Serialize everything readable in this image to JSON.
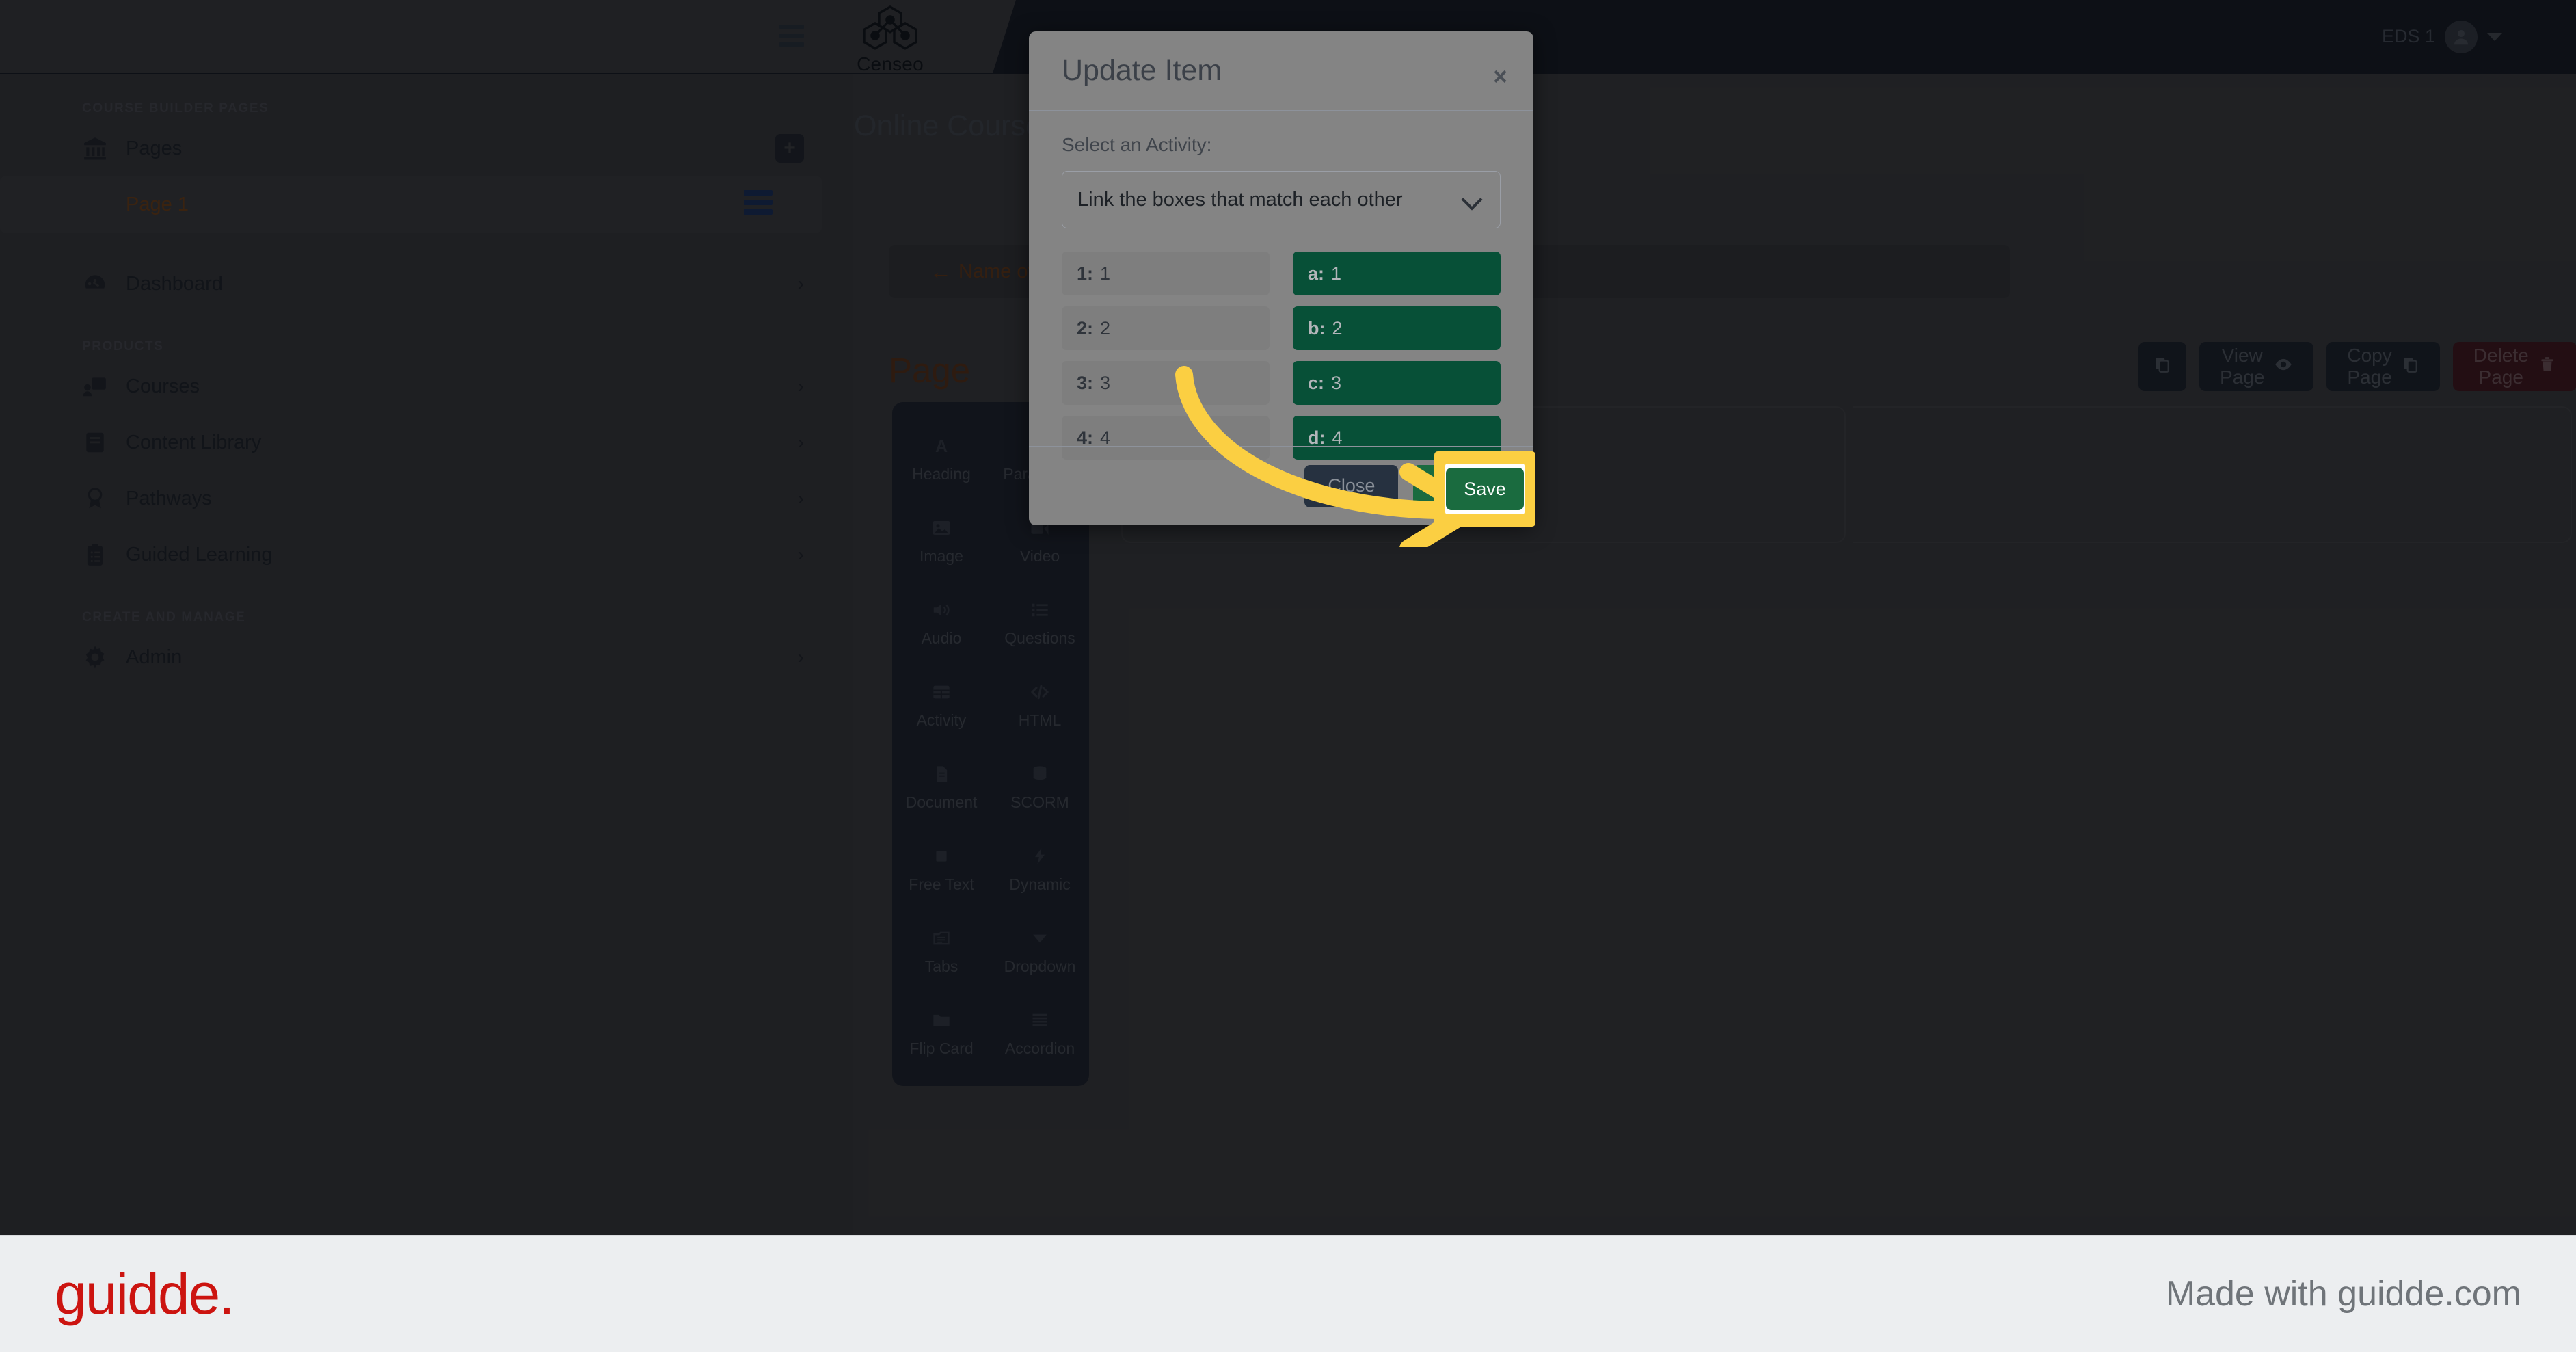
{
  "topbar": {
    "menu_icon": "hamburger-icon",
    "brand_name": "Censeo",
    "brand_mark_icon": "censeo-molecule-logo",
    "user_name": "EDS 1",
    "avatar_icon": "user-avatar-icon",
    "caret_icon": "chevron-down-icon"
  },
  "sidebar": {
    "groups": [
      {
        "label": "COURSE BUILDER PAGES",
        "items": [
          {
            "label": "Pages",
            "icon": "bank-icon",
            "trailing": "plus-icon",
            "active": false
          },
          {
            "label": "Page 1",
            "icon": "none",
            "trailing": "list-burger-icon",
            "active": true
          }
        ]
      },
      {
        "label": "",
        "items": [
          {
            "label": "Dashboard",
            "icon": "gauge-icon",
            "trailing": "chevron-right-icon",
            "active": false
          }
        ]
      },
      {
        "label": "PRODUCTS",
        "items": [
          {
            "label": "Courses",
            "icon": "presentation-icon",
            "trailing": "chevron-right-icon",
            "active": false
          },
          {
            "label": "Content Library",
            "icon": "book-icon",
            "trailing": "chevron-right-icon",
            "active": false
          },
          {
            "label": "Pathways",
            "icon": "award-icon",
            "trailing": "chevron-right-icon",
            "active": false
          },
          {
            "label": "Guided Learning",
            "icon": "clipboard-list-icon",
            "trailing": "chevron-right-icon",
            "active": false
          }
        ]
      },
      {
        "label": "CREATE AND MANAGE",
        "items": [
          {
            "label": "Admin",
            "icon": "gear-icon",
            "trailing": "chevron-right-icon",
            "active": false
          }
        ]
      }
    ]
  },
  "main": {
    "heading": "Online Course Builder",
    "breadcrumb_arrow_icon": "arrow-left-icon",
    "breadcrumb": "Name of your course",
    "page_title": "Page",
    "actions": [
      {
        "label": "",
        "icon": "copy-icon",
        "style": "dark"
      },
      {
        "label": "View Page",
        "icon": "eye-icon",
        "style": "dark"
      },
      {
        "label": "Copy Page",
        "icon": "copy-icon",
        "style": "dark"
      },
      {
        "label": "Delete Page",
        "icon": "trash-icon",
        "style": "danger"
      }
    ],
    "palette": [
      {
        "label": "Heading",
        "icon": "heading-a-icon"
      },
      {
        "label": "Paragraph",
        "icon": "paragraph-icon"
      },
      {
        "label": "Image",
        "icon": "image-icon"
      },
      {
        "label": "Video",
        "icon": "video-icon"
      },
      {
        "label": "Audio",
        "icon": "audio-icon"
      },
      {
        "label": "Questions",
        "icon": "list-icon"
      },
      {
        "label": "Activity",
        "icon": "table-icon"
      },
      {
        "label": "HTML",
        "icon": "code-icon"
      },
      {
        "label": "Document",
        "icon": "file-icon"
      },
      {
        "label": "SCORM",
        "icon": "database-icon"
      },
      {
        "label": "Free Text",
        "icon": "square-icon"
      },
      {
        "label": "Dynamic",
        "icon": "bolt-icon"
      },
      {
        "label": "Tabs",
        "icon": "folder-lines-icon"
      },
      {
        "label": "Dropdown",
        "icon": "triangle-down-icon"
      },
      {
        "label": "Flip Card",
        "icon": "folder-icon"
      },
      {
        "label": "Accordion",
        "icon": "lines-icon"
      }
    ]
  },
  "modal": {
    "title": "Update Item",
    "close_icon": "close-x-icon",
    "field_label": "Select an Activity:",
    "select_value": "Link the boxes that match each other",
    "select_chevron_icon": "chevron-down-icon",
    "pairs": [
      {
        "left_key": "1:",
        "left_value": "1",
        "right_key": "a:",
        "right_value": "1"
      },
      {
        "left_key": "2:",
        "left_value": "2",
        "right_key": "b:",
        "right_value": "2"
      },
      {
        "left_key": "3:",
        "left_value": "3",
        "right_key": "c:",
        "right_value": "3"
      },
      {
        "left_key": "4:",
        "left_value": "4",
        "right_key": "d:",
        "right_value": "4"
      }
    ],
    "close_button": "Close",
    "save_button": "Save"
  },
  "annotation": {
    "arrow_icon": "curved-arrow-right-icon",
    "highlight_color": "#fbcf42"
  },
  "footer": {
    "logo": "guidde.",
    "made_with": "Made with guidde.com"
  },
  "colors": {
    "accent_orange": "#8a4a12",
    "green": "#075037",
    "danger": "#4d141a",
    "highlight": "#fbcf42",
    "brand_red": "#cc1410"
  }
}
